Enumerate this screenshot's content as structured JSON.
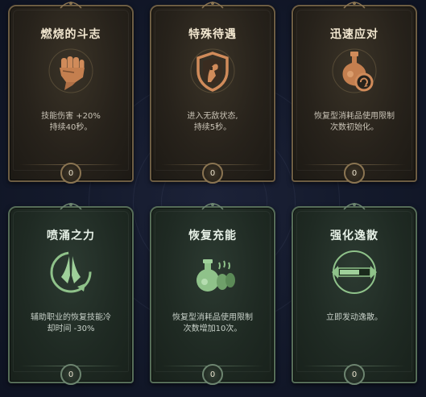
{
  "cards": [
    {
      "title": "燃烧的斗志",
      "desc": [
        "技能伤害 +20%",
        "持续40秒。"
      ],
      "count": "0",
      "icon": "fist-icon",
      "theme": "gold"
    },
    {
      "title": "特殊待遇",
      "desc": [
        "进入无敌状态,",
        "持续5秒。"
      ],
      "count": "0",
      "icon": "shield-knight-icon",
      "theme": "gold"
    },
    {
      "title": "迅速应对",
      "desc": [
        "恢复型消耗品使用限制",
        "次数初始化。"
      ],
      "count": "0",
      "icon": "potion-refresh-icon",
      "theme": "gold"
    },
    {
      "title": "喷涌之力",
      "desc": [
        "辅助职业的恢复技能冷",
        "却时间 -30%"
      ],
      "count": "0",
      "icon": "praying-hands-icon",
      "theme": "green"
    },
    {
      "title": "恢复充能",
      "desc": [
        "恢复型消耗品使用限制",
        "次数增加10次。"
      ],
      "count": "0",
      "icon": "potions-icon",
      "theme": "green"
    },
    {
      "title": "强化逸散",
      "desc": [
        "立即发动逸散。"
      ],
      "count": "0",
      "icon": "gauge-bar-icon",
      "theme": "green"
    }
  ],
  "colors": {
    "gold_accent": "#c98a55",
    "green_accent": "#8fc28a"
  }
}
